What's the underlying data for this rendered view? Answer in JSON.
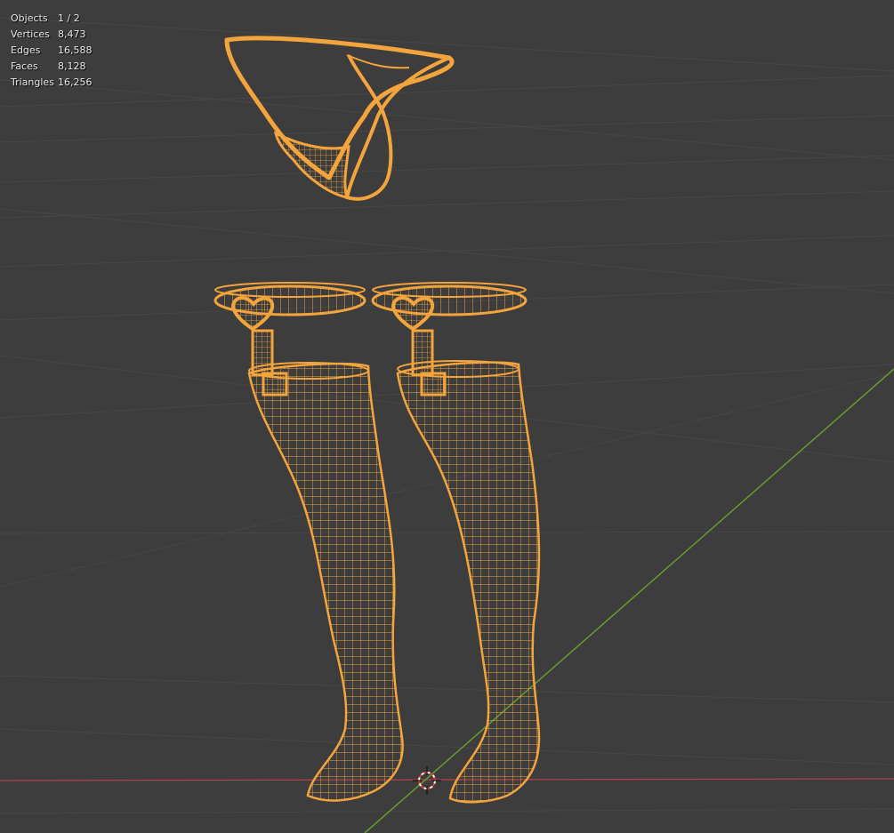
{
  "viewport": {
    "background": "#3d3d3d",
    "grid_color": "#4a4a4a",
    "x_axis_color": "#b04446",
    "y_axis_color": "#6a9a2f",
    "selection_color": "#f4a43c",
    "cursor_icon": "3d-cursor-icon"
  },
  "statistics": [
    {
      "label": "Objects",
      "value": "1 / 2"
    },
    {
      "label": "Vertices",
      "value": "8,473"
    },
    {
      "label": "Edges",
      "value": "16,588"
    },
    {
      "label": "Faces",
      "value": "8,128"
    },
    {
      "label": "Triangles",
      "value": "16,256"
    }
  ]
}
